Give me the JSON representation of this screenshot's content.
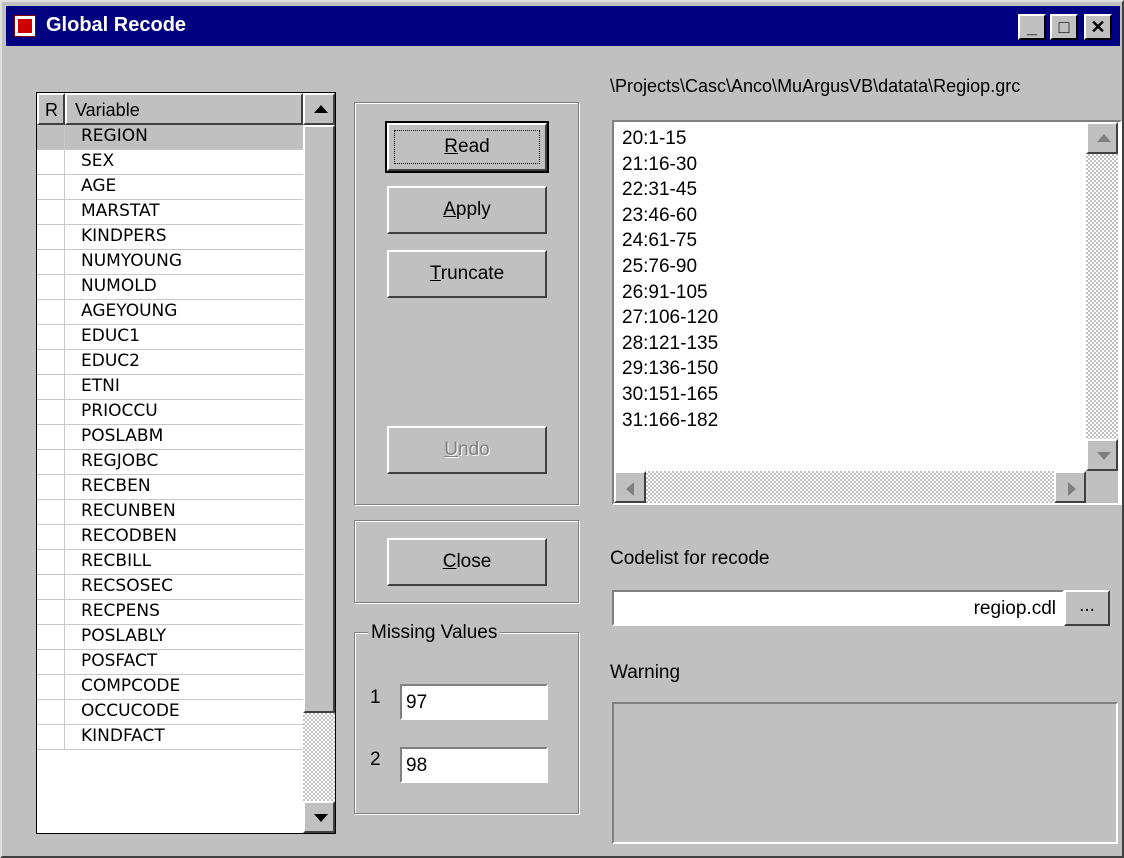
{
  "window": {
    "title": "Global Recode",
    "minimize": "_",
    "maximize": "□",
    "close": "✕"
  },
  "list": {
    "headers": [
      "R",
      "Variable"
    ],
    "selected_index": 0,
    "items": [
      "REGION",
      "SEX",
      "AGE",
      "MARSTAT",
      "KINDPERS",
      "NUMYOUNG",
      "NUMOLD",
      "AGEYOUNG",
      "EDUC1",
      "EDUC2",
      "ETNI",
      "PRIOCCU",
      "POSLABM",
      "REGJOBC",
      "RECBEN",
      "RECUNBEN",
      "RECODBEN",
      "RECBILL",
      "RECSOSEC",
      "RECPENS",
      "POSLABLY",
      "POSFACT",
      "COMPCODE",
      "OCCUCODE",
      "KINDFACT"
    ]
  },
  "buttons": {
    "read": {
      "key": "R",
      "rest": "ead"
    },
    "apply": {
      "key": "A",
      "rest": "pply"
    },
    "truncate": {
      "key": "T",
      "rest": "runcate"
    },
    "undo": {
      "key": "U",
      "rest": "ndo"
    },
    "close": {
      "key": "C",
      "rest": "lose"
    }
  },
  "missing_values": {
    "title": "Missing Values",
    "label1": "1",
    "value1": "97",
    "label2": "2",
    "value2": "98"
  },
  "file_path": "\\Projects\\Casc\\Anco\\MuArgusVB\\datata\\Regiop.grc",
  "recode_lines": [
    "20:1-15",
    "21:16-30",
    "22:31-45",
    "23:46-60",
    "24:61-75",
    "25:76-90",
    "26:91-105",
    "27:106-120",
    "28:121-135",
    "29:136-150",
    "30:151-165",
    "31:166-182"
  ],
  "codelist": {
    "label": "Codelist for recode",
    "value": "regiop.cdl",
    "browse": "..."
  },
  "warning": {
    "label": "Warning",
    "text": ""
  }
}
